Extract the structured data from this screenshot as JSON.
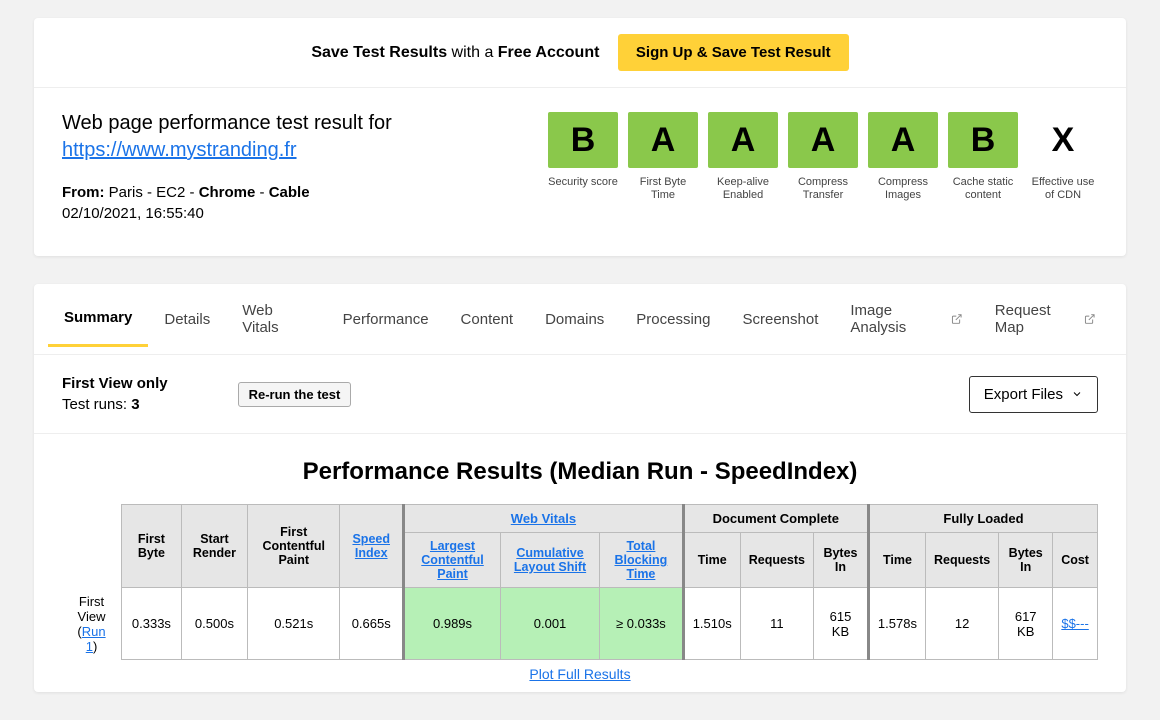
{
  "banner": {
    "prefix": "Save Test Results",
    "mid": " with a ",
    "suffix": "Free Account",
    "button": "Sign Up & Save Test Result"
  },
  "header": {
    "title_prefix": "Web page performance test result for",
    "url": "https://www.mystranding.fr",
    "from_label": "From:",
    "from_loc": " Paris - EC2 - ",
    "from_browser": "Chrome",
    "from_sep": " - ",
    "from_conn": "Cable",
    "timestamp": "02/10/2021, 16:55:40"
  },
  "grades": [
    {
      "letter": "B",
      "label": "Security score",
      "css": "grade-green"
    },
    {
      "letter": "A",
      "label": "First Byte Time",
      "css": "grade-green"
    },
    {
      "letter": "A",
      "label": "Keep-alive Enabled",
      "css": "grade-green"
    },
    {
      "letter": "A",
      "label": "Compress Transfer",
      "css": "grade-green"
    },
    {
      "letter": "A",
      "label": "Compress Images",
      "css": "grade-green"
    },
    {
      "letter": "B",
      "label": "Cache static content",
      "css": "grade-green"
    },
    {
      "letter": "X",
      "label": "Effective use of CDN",
      "css": "grade-none"
    }
  ],
  "tabs": {
    "summary": "Summary",
    "details": "Details",
    "webvitals": "Web Vitals",
    "performance": "Performance",
    "content": "Content",
    "domains": "Domains",
    "processing": "Processing",
    "screenshot": "Screenshot",
    "image_analysis": "Image Analysis",
    "request_map": "Request Map"
  },
  "runbar": {
    "first_view_only": "First View only",
    "test_runs_label": "Test runs: ",
    "test_runs": "3",
    "rerun": "Re-run the test",
    "export": "Export Files"
  },
  "results": {
    "title": "Performance Results (Median Run - SpeedIndex)",
    "group_headers": {
      "web_vitals": "Web Vitals",
      "doc_complete": "Document Complete",
      "fully_loaded": "Fully Loaded"
    },
    "col_headers": {
      "first_byte": "First Byte",
      "start_render": "Start Render",
      "fcp": "First Contentful Paint",
      "speed_index": "Speed Index",
      "lcp": "Largest Contentful Paint",
      "cls": "Cumulative Layout Shift",
      "tbt": "Total Blocking Time",
      "time1": "Time",
      "requests1": "Requests",
      "bytes1": "Bytes In",
      "time2": "Time",
      "requests2": "Requests",
      "bytes2": "Bytes In",
      "cost": "Cost"
    },
    "row": {
      "label_prefix": "First View (",
      "label_link": "Run 1",
      "label_suffix": ")",
      "first_byte": "0.333s",
      "start_render": "0.500s",
      "fcp": "0.521s",
      "speed_index": "0.665s",
      "lcp": "0.989s",
      "cls": "0.001",
      "tbt": "≥ 0.033s",
      "time1": "1.510s",
      "requests1": "11",
      "bytes1": "615 KB",
      "time2": "1.578s",
      "requests2": "12",
      "bytes2": "617 KB",
      "cost": "$$---"
    },
    "plot_link": "Plot Full Results"
  }
}
